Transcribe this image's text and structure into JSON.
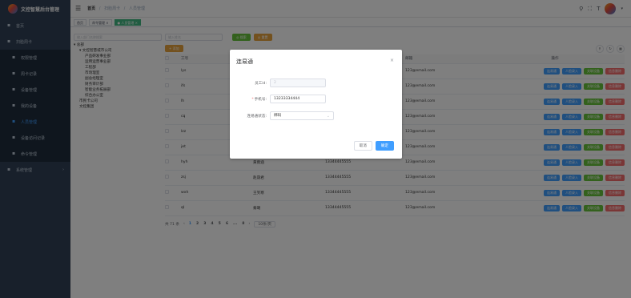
{
  "app": {
    "title": "文控智慧后台管理"
  },
  "sidebar": {
    "items": [
      {
        "label": "首页",
        "icon": "home-icon"
      },
      {
        "label": "扫脸周卡",
        "icon": "scan-face-icon",
        "expanded": true
      },
      {
        "label": "权限管理",
        "icon": "gear-icon",
        "sub": true
      },
      {
        "label": "周卡记录",
        "icon": "card-icon",
        "sub": true
      },
      {
        "label": "设备管理",
        "icon": "device-icon",
        "sub": true
      },
      {
        "label": "我的设备",
        "icon": "my-device-icon",
        "sub": true
      },
      {
        "label": "人员管理",
        "icon": "people-icon",
        "sub": true,
        "active": true
      },
      {
        "label": "设备访问记录",
        "icon": "log-icon",
        "sub": true
      },
      {
        "label": "命令管理",
        "icon": "command-icon",
        "sub": true
      },
      {
        "label": "系统管理",
        "icon": "gear-icon",
        "arrow": "›"
      }
    ]
  },
  "breadcrumb": {
    "home": "首页",
    "mid": "扫脸周卡",
    "current": "人员管理",
    "sep": "/"
  },
  "tags": [
    {
      "label": "首页",
      "active": false
    },
    {
      "label": "命令管理 ×",
      "active": false
    },
    {
      "label": "● 人员管理 ×",
      "active": true
    }
  ],
  "tree": {
    "search_placeholder": "输入部门名称搜索",
    "nodes": [
      {
        "label": "▾ 总部",
        "level": 1
      },
      {
        "label": "▾ 文控智慧城市公司",
        "level": 2
      },
      {
        "label": "产品研发事业部",
        "level": 3
      },
      {
        "label": "运用运营事业部",
        "level": 3
      },
      {
        "label": "工程部",
        "level": 3
      },
      {
        "label": "市场理室",
        "level": 3
      },
      {
        "label": "副总经理室",
        "level": 3
      },
      {
        "label": "财务审计部",
        "level": 3
      },
      {
        "label": "智能业务拓展部",
        "level": 3
      },
      {
        "label": "综合办公室",
        "level": 3
      },
      {
        "label": "市民卡公司",
        "level": 2
      },
      {
        "label": "文控集团",
        "level": 2
      }
    ]
  },
  "search": {
    "placeholder": "输入姓名",
    "search_btn": "◎ 搜索",
    "reset_btn": "◎ 重置",
    "add_btn": "+ 添加"
  },
  "table": {
    "headers": [
      "工号",
      "",
      "",
      "邮箱",
      "操作"
    ],
    "rows": [
      {
        "id": "lys",
        "name": "",
        "phone": "",
        "email": "123@email.com"
      },
      {
        "id": "ifs",
        "name": "",
        "phone": "",
        "email": "123@email.com"
      },
      {
        "id": "lh",
        "name": "",
        "phone": "",
        "email": "123@email.com"
      },
      {
        "id": "cq",
        "name": "",
        "phone": "",
        "email": "123@email.com"
      },
      {
        "id": "lzz",
        "name": "",
        "phone": "",
        "email": "123@email.com"
      },
      {
        "id": "jet",
        "name": "",
        "phone": "",
        "email": "123@email.com"
      },
      {
        "id": "hyh",
        "name": "黄雨涵",
        "phone": "13344445555",
        "email": "123@email.com"
      },
      {
        "id": "zsj",
        "name": "赵晟君",
        "phone": "13344445555",
        "email": "123@email.com"
      },
      {
        "id": "wxh",
        "name": "王笑寒",
        "phone": "13344445555",
        "email": "123@email.com"
      },
      {
        "id": "ql",
        "name": "秦璐",
        "phone": "13344445555",
        "email": "123@email.com"
      }
    ],
    "op_labels": {
      "edit": "连易通",
      "person_in": "人脸录入",
      "bind": "关联设备",
      "delete": "信息删除"
    }
  },
  "pagination": {
    "total": "共 71 条",
    "prev": "‹",
    "pages": [
      "1",
      "2",
      "3",
      "4",
      "5",
      "6",
      "...",
      "8"
    ],
    "next": "›",
    "size": "10条/页"
  },
  "dialog": {
    "title": "连易通",
    "close": "×",
    "fields": {
      "staff_id_label": "员工id:",
      "staff_id_value": "2",
      "phone_label": "手机号:",
      "phone_value": "13233334444",
      "status_label": "连易通状态:",
      "status_value": "绑码"
    },
    "cancel": "取消",
    "ok": "确定"
  },
  "colors": {
    "sidebar": "#304156",
    "primary": "#409eff",
    "success": "#67c23a",
    "warning": "#e6a23c",
    "danger": "#f56c6c"
  }
}
